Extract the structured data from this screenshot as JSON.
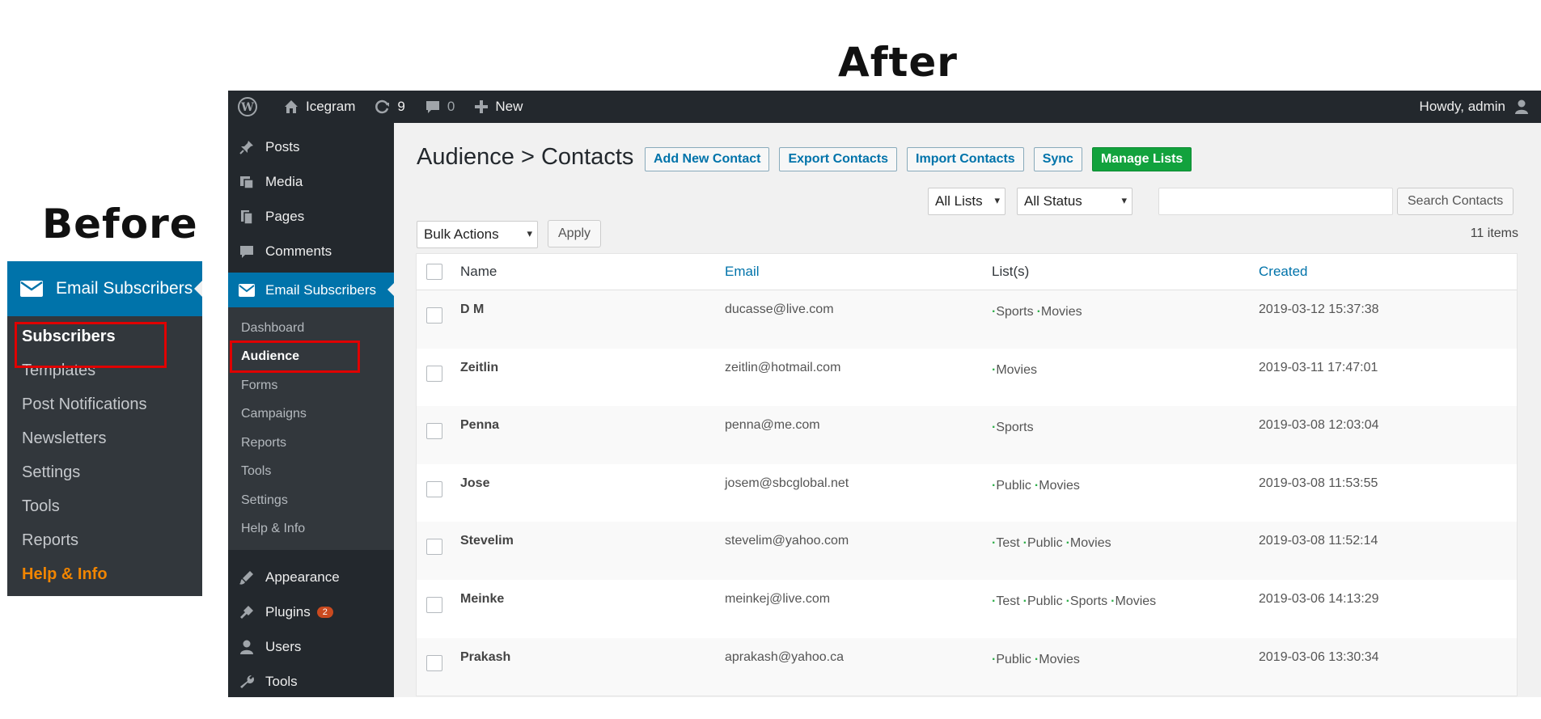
{
  "labels": {
    "before": "Before",
    "after": "After"
  },
  "before": {
    "header": "Email Subscribers",
    "items": [
      {
        "label": "Subscribers",
        "style": "bold"
      },
      {
        "label": "Templates",
        "style": "normal"
      },
      {
        "label": "Post Notifications",
        "style": "normal"
      },
      {
        "label": "Newsletters",
        "style": "normal"
      },
      {
        "label": "Settings",
        "style": "normal"
      },
      {
        "label": "Tools",
        "style": "normal"
      },
      {
        "label": "Reports",
        "style": "normal"
      },
      {
        "label": "Help & Info",
        "style": "orange"
      }
    ]
  },
  "adminbar": {
    "site": "Icegram",
    "updates": "9",
    "comments": "0",
    "new_label": "New",
    "howdy": "Howdy, admin"
  },
  "sidebar": {
    "top": [
      "Posts",
      "Media",
      "Pages",
      "Comments"
    ],
    "active": "Email Subscribers",
    "submenu": [
      "Dashboard",
      "Audience",
      "Forms",
      "Campaigns",
      "Reports",
      "Tools",
      "Settings",
      "Help & Info"
    ],
    "current_sub": "Audience",
    "bottom": [
      "Appearance",
      "Plugins",
      "Users",
      "Tools"
    ],
    "plugins_badge": "2"
  },
  "page": {
    "title": "Audience > Contacts",
    "buttons": [
      "Add New Contact",
      "Export Contacts",
      "Import Contacts",
      "Sync",
      "Manage Lists"
    ],
    "filters": {
      "lists": "All Lists",
      "status": "All Status",
      "search_button": "Search Contacts"
    },
    "bulk": {
      "label": "Bulk Actions",
      "apply": "Apply"
    },
    "items_count": "11 items"
  },
  "table": {
    "headers": {
      "name": "Name",
      "email": "Email",
      "lists": "List(s)",
      "created": "Created"
    },
    "rows": [
      {
        "name": "D M",
        "email": "ducasse@live.com",
        "lists": [
          "Sports",
          "Movies"
        ],
        "created": "2019-03-12 15:37:38"
      },
      {
        "name": "Zeitlin",
        "email": "zeitlin@hotmail.com",
        "lists": [
          "Movies"
        ],
        "created": "2019-03-11 17:47:01"
      },
      {
        "name": "Penna",
        "email": "penna@me.com",
        "lists": [
          "Sports"
        ],
        "created": "2019-03-08 12:03:04"
      },
      {
        "name": "Jose",
        "email": "josem@sbcglobal.net",
        "lists": [
          "Public",
          "Movies"
        ],
        "created": "2019-03-08 11:53:55"
      },
      {
        "name": "Stevelim",
        "email": "stevelim@yahoo.com",
        "lists": [
          "Test",
          "Public",
          "Movies"
        ],
        "created": "2019-03-08 11:52:14"
      },
      {
        "name": "Meinke",
        "email": "meinkej@live.com",
        "lists": [
          "Test",
          "Public",
          "Sports",
          "Movies"
        ],
        "created": "2019-03-06 14:13:29"
      },
      {
        "name": "Prakash",
        "email": "aprakash@yahoo.ca",
        "lists": [
          "Public",
          "Movies"
        ],
        "created": "2019-03-06 13:30:34"
      }
    ]
  }
}
